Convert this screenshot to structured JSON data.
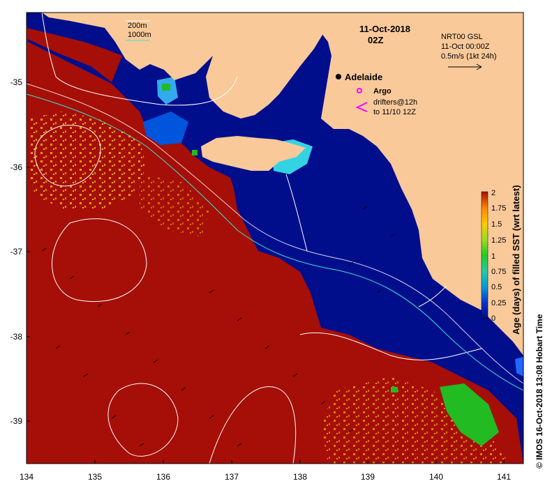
{
  "map": {
    "date_line1": "11-Oct-2018",
    "date_line2": "02Z",
    "source_line1": "NRT00 GSL",
    "source_line2": "11-Oct 00:00Z",
    "current_scale_label": "0.5m/s (1kt 24h)",
    "isobath_200": "200m",
    "isobath_1000": "1000m",
    "city_label": "Adelaide",
    "argo_label": "Argo",
    "drifters_line1": "drifters@12h",
    "drifters_line2": "to 11/10 12Z",
    "credit": "© IMOS 16-Oct-2018 13:08 Hobart Time",
    "x_ticks": [
      "134",
      "135",
      "136",
      "137",
      "138",
      "139",
      "140",
      "141"
    ],
    "y_ticks": [
      "-35",
      "-36",
      "-37",
      "-38",
      "-39"
    ],
    "colorbar": {
      "label": "Age (days) of filled SST (wrt latest)",
      "ticks": [
        "2",
        "1.75",
        "1.5",
        "1.25",
        "1",
        "0.75",
        "0.5",
        "0.25",
        "0"
      ]
    },
    "colors": {
      "land": "#F9C99A",
      "age_old": "#A50F08",
      "age_new": "#000E8C",
      "contour": "#FFFFFF",
      "shelf_contour": "#40E0D0",
      "argo": "#FF00FF"
    }
  }
}
